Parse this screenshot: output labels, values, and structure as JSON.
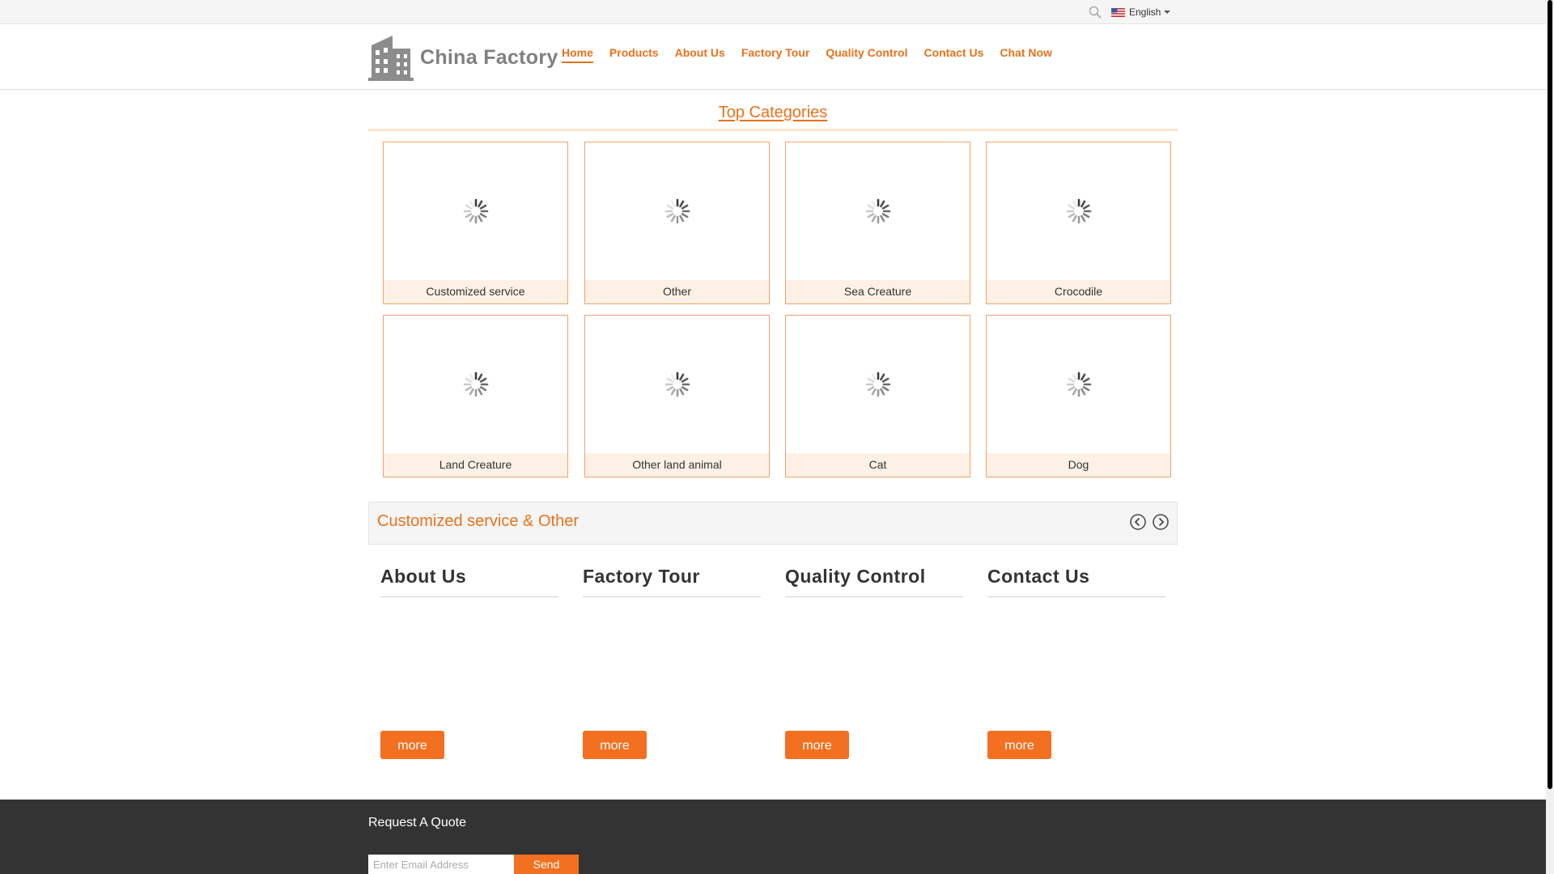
{
  "language": {
    "selected": "English",
    "flag": "us-flag-icon"
  },
  "brand": {
    "name": "China Factory",
    "icon": "factory-building-icon"
  },
  "nav": {
    "items": [
      {
        "label": "Home",
        "active": true
      },
      {
        "label": "Products"
      },
      {
        "label": "About Us"
      },
      {
        "label": "Factory Tour"
      },
      {
        "label": "Quality Control"
      },
      {
        "label": "Contact Us"
      },
      {
        "label": "Chat Now"
      }
    ]
  },
  "top_categories": {
    "title": "Top Categories",
    "items": [
      {
        "label": "Customized service"
      },
      {
        "label": "Other"
      },
      {
        "label": "Sea Creature"
      },
      {
        "label": "Crocodile"
      },
      {
        "label": "Land Creature"
      },
      {
        "label": "Other land animal"
      },
      {
        "label": "Cat"
      },
      {
        "label": "Dog"
      }
    ]
  },
  "strip": {
    "title": "Customized service & Other"
  },
  "info_columns": [
    {
      "title": "About Us",
      "more": "more"
    },
    {
      "title": "Factory Tour",
      "more": "more"
    },
    {
      "title": "Quality Control",
      "more": "more"
    },
    {
      "title": "Contact Us",
      "more": "more"
    }
  ],
  "footer": {
    "title": "Request A Quote",
    "email_placeholder": "Enter Email Address",
    "send_label": "Send"
  },
  "colors": {
    "accent": "#e8721c",
    "button": "#f37021",
    "card_border": "#f0a36b",
    "footer_bg": "#333333"
  }
}
